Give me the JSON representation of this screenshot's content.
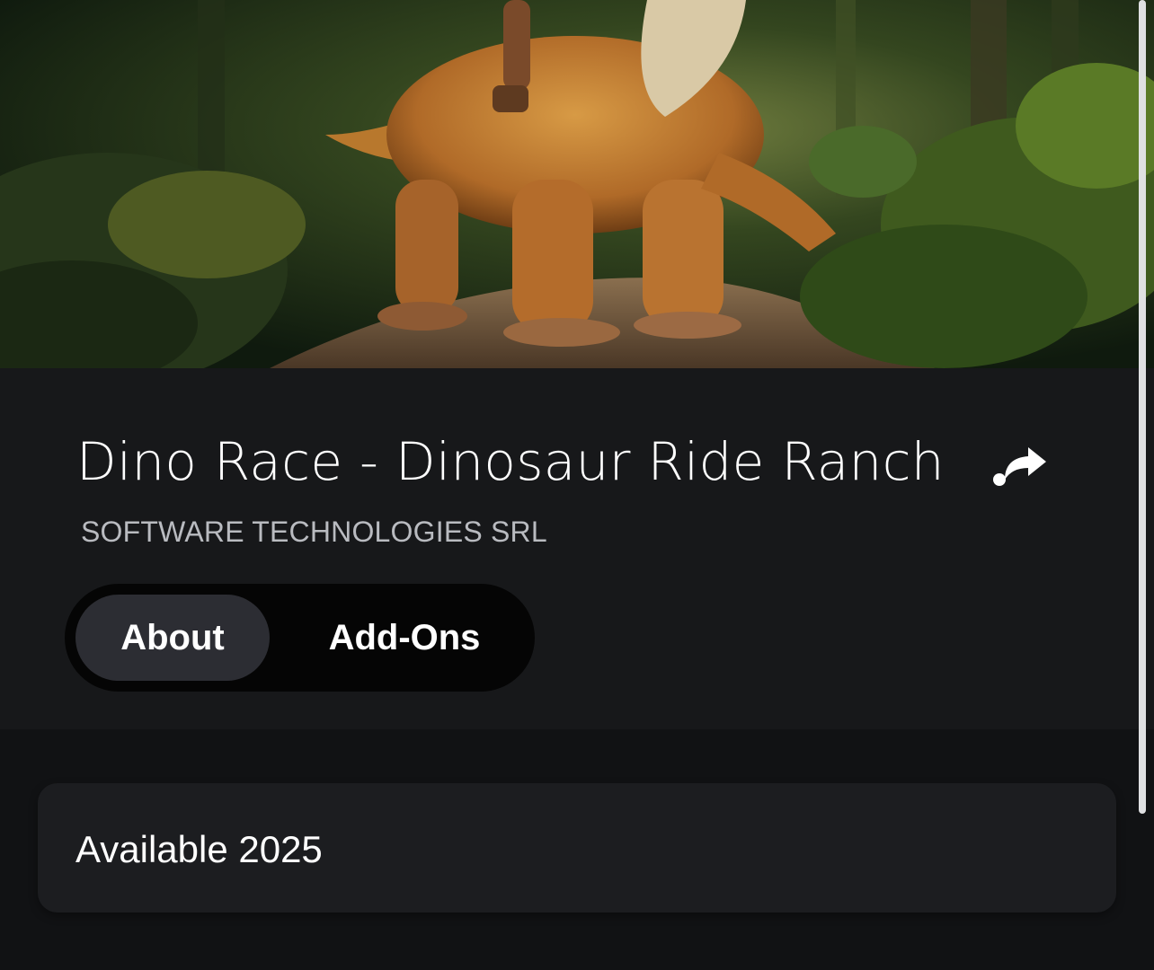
{
  "hero": {
    "description_icon": "hero-art-image"
  },
  "game": {
    "title": "Dino Race - Dinosaur Ride Ranch",
    "publisher": "SOFTWARE TECHNOLOGIES SRL"
  },
  "share": {
    "icon": "share-icon"
  },
  "tabs": [
    {
      "label": "About",
      "active": true
    },
    {
      "label": "Add-Ons",
      "active": false
    }
  ],
  "info": {
    "availability": "Available 2025"
  },
  "colors": {
    "background": "#131416",
    "header_bg": "#17181a",
    "tab_active_bg": "#2c2d33",
    "tab_bar_bg": "#050505",
    "card_bg": "#1c1d20",
    "text_primary": "#ffffff",
    "text_secondary": "#b9bbc0"
  }
}
